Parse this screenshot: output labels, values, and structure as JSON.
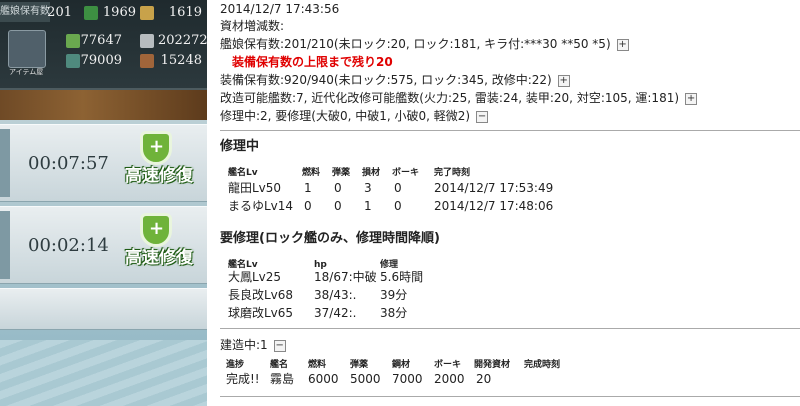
{
  "game": {
    "resources": {
      "ship_label": "艦娘保有数",
      "ship_count": "201",
      "fuel": "1969",
      "repair_tools": "1619",
      "item_label": "アイテム屋",
      "ammo": "77647",
      "steel": "202272",
      "bauxite": "79009",
      "buckets": "15248"
    },
    "docks": [
      {
        "time": "00:07:57",
        "button": "高速修復"
      },
      {
        "time": "00:02:14",
        "button": "高速修復"
      }
    ]
  },
  "info": {
    "timestamp": "2014/12/7 17:43:56",
    "resource_change": "資材増減数:",
    "ships_line": "艦娘保有数:201/210(未ロック:20, ロック:181, キラ付:***30 **50 *5)",
    "ships_warning": "装備保有数の上限まで残り20",
    "equip_line": "装備保有数:920/940(未ロック:575, ロック:345, 改修中:22)",
    "upgrade_line": "改造可能艦数:7, 近代化改修可能艦数(火力:25, 雷装:24, 装甲:20, 対空:105, 運:181)",
    "repair_line": "修理中:2, 要修理(大破0, 中破1, 小破0, 軽微2)",
    "plus": "+",
    "minus": "−",
    "repairing": {
      "title": "修理中",
      "headers": [
        "艦名Lv",
        "燃料",
        "弾薬",
        "損材",
        "ボーキ",
        "完了時刻"
      ],
      "rows": [
        [
          "龍田Lv50",
          "1",
          "0",
          "3",
          "0",
          "2014/12/7 17:53:49"
        ],
        [
          "まるゆLv14",
          "0",
          "0",
          "1",
          "0",
          "2014/12/7 17:48:06"
        ]
      ]
    },
    "needs_repair": {
      "title": "要修理(ロック艦のみ、修理時間降順)",
      "headers": [
        "艦名Lv",
        "hp",
        "修理"
      ],
      "rows": [
        [
          "大鳳Lv25",
          "18/67:中破",
          "5.6時間"
        ],
        [
          "長良改Lv68",
          "38/43:.",
          "39分"
        ],
        [
          "球磨改Lv65",
          "37/42:.",
          "38分"
        ]
      ]
    },
    "building": {
      "title": "建造中:1",
      "headers": [
        "進捗",
        "艦名",
        "燃料",
        "弾薬",
        "鋼材",
        "ボーキ",
        "開発資材",
        "完成時刻"
      ],
      "rows": [
        [
          "完成!!",
          "霧島",
          "6000",
          "5000",
          "7000",
          "2000",
          "20",
          ""
        ]
      ]
    }
  }
}
